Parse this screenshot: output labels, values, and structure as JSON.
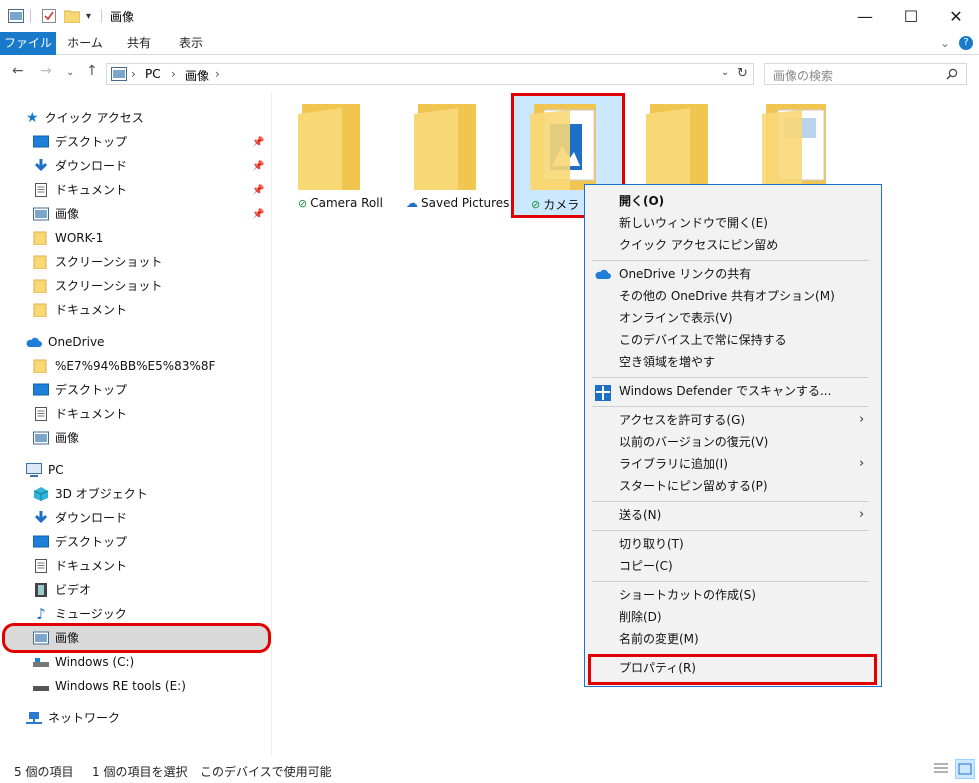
{
  "window": {
    "title": "画像",
    "controls": {
      "minimize": "—",
      "maximize": "☐",
      "close": "✕"
    }
  },
  "ribbon": {
    "tabs": [
      {
        "label": "ファイル"
      },
      {
        "label": "ホーム"
      },
      {
        "label": "共有"
      },
      {
        "label": "表示"
      }
    ]
  },
  "address": {
    "crumbs": [
      "PC",
      "画像"
    ],
    "search_placeholder": "画像の検索"
  },
  "nav": {
    "quick_access": "クイック アクセス",
    "quick_items": [
      {
        "label": "デスクトップ",
        "icon": "desktop-icon",
        "pinned": true
      },
      {
        "label": "ダウンロード",
        "icon": "download-icon",
        "pinned": true
      },
      {
        "label": "ドキュメント",
        "icon": "document-icon",
        "pinned": true
      },
      {
        "label": "画像",
        "icon": "pictures-icon",
        "pinned": true
      },
      {
        "label": "WORK-1",
        "icon": "folder-icon"
      },
      {
        "label": "スクリーンショット",
        "icon": "folder-icon"
      },
      {
        "label": "スクリーンショット",
        "icon": "folder-icon"
      },
      {
        "label": "ドキュメント",
        "icon": "folder-icon"
      }
    ],
    "onedrive": "OneDrive",
    "onedrive_items": [
      {
        "label": "%E7%94%BB%E5%83%8F",
        "icon": "folder-icon"
      },
      {
        "label": "デスクトップ",
        "icon": "desktop-icon"
      },
      {
        "label": "ドキュメント",
        "icon": "document-icon"
      },
      {
        "label": "画像",
        "icon": "pictures-icon"
      }
    ],
    "pc": "PC",
    "pc_items": [
      {
        "label": "3D オブジェクト",
        "icon": "3d-objects-icon"
      },
      {
        "label": "ダウンロード",
        "icon": "download-icon"
      },
      {
        "label": "デスクトップ",
        "icon": "desktop-icon"
      },
      {
        "label": "ドキュメント",
        "icon": "document-icon"
      },
      {
        "label": "ビデオ",
        "icon": "video-icon"
      },
      {
        "label": "ミュージック",
        "icon": "music-icon"
      },
      {
        "label": "画像",
        "icon": "pictures-icon",
        "selected": true
      },
      {
        "label": "Windows (C:)",
        "icon": "drive-icon"
      },
      {
        "label": "Windows RE tools (E:)",
        "icon": "drive-icon"
      }
    ],
    "network": "ネットワーク"
  },
  "content": {
    "folders": [
      {
        "label": "Camera Roll",
        "status": "synced"
      },
      {
        "label": "Saved Pictures",
        "status": "cloud"
      },
      {
        "label": "カメラ ロ",
        "status": "synced",
        "selected": true
      },
      {
        "label": ""
      },
      {
        "label": ""
      }
    ]
  },
  "context_menu": {
    "groups": [
      [
        "開く(O)",
        "新しいウィンドウで開く(E)",
        "クイック アクセスにピン留め"
      ],
      [
        "OneDrive リンクの共有",
        "その他の OneDrive 共有オプション(M)",
        "オンラインで表示(V)",
        "このデバイス上で常に保持する",
        "空き領域を増やす"
      ],
      [
        "Windows Defender でスキャンする..."
      ],
      [
        "アクセスを許可する(G)",
        "以前のバージョンの復元(V)",
        "ライブラリに追加(I)",
        "スタートにピン留めする(P)"
      ],
      [
        "送る(N)"
      ],
      [
        "切り取り(T)",
        "コピー(C)"
      ],
      [
        "ショートカットの作成(S)",
        "削除(D)",
        "名前の変更(M)"
      ],
      [
        "プロパティ(R)"
      ]
    ]
  },
  "status": {
    "count": "5 個の項目",
    "selected": "1 個の項目を選択",
    "availability": "このデバイスで使用可能"
  },
  "colors": {
    "accent": "#1979ca",
    "highlight_red": "#e00000",
    "menu_border": "#1a6fd8",
    "folder": "#f8d775"
  }
}
